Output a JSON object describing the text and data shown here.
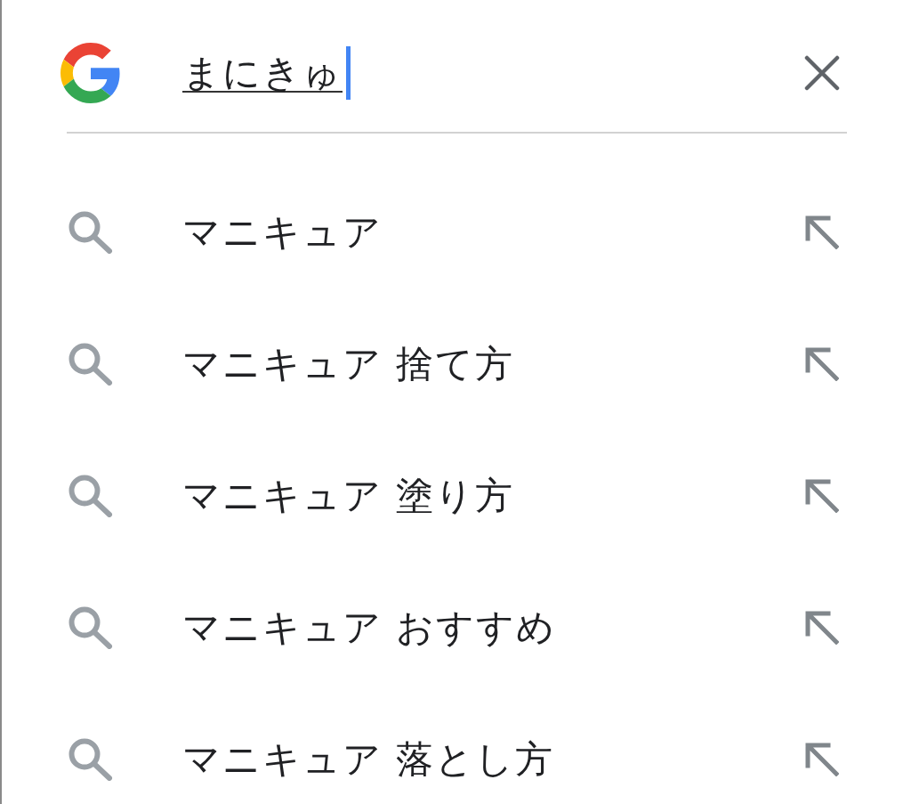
{
  "search": {
    "value": "まにきゅ",
    "composing": true,
    "focused": true
  },
  "suggestions": [
    {
      "text": "マニキュア"
    },
    {
      "text": "マニキュア 捨て方"
    },
    {
      "text": "マニキュア 塗り方"
    },
    {
      "text": "マニキュア おすすめ"
    },
    {
      "text": "マニキュア 落とし方"
    }
  ]
}
